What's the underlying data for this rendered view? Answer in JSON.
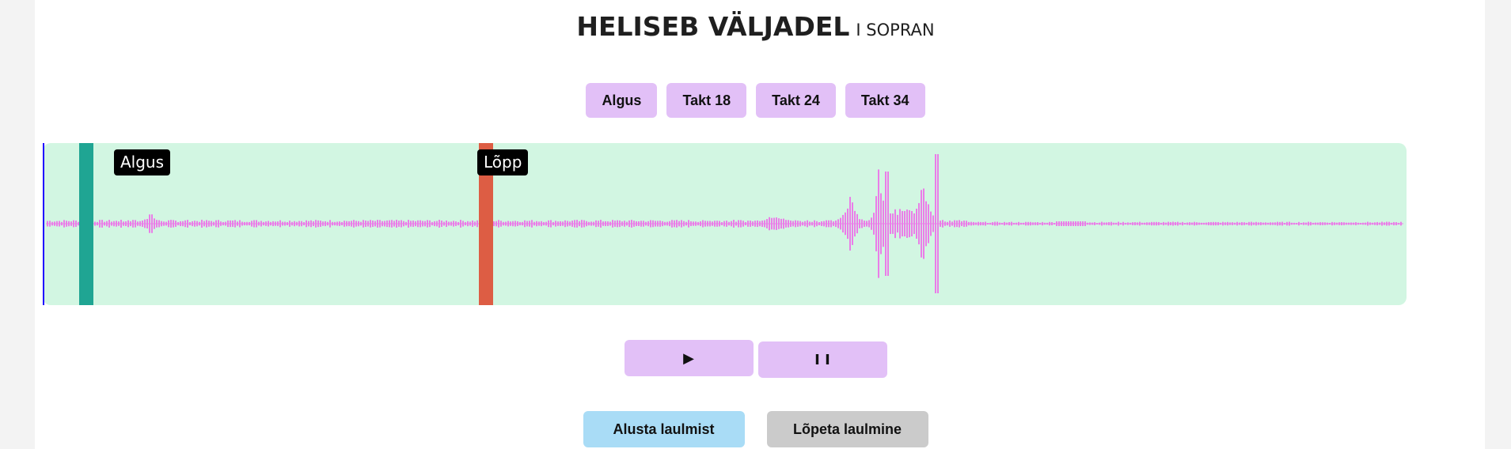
{
  "header": {
    "title": "HELISEB VÄLJADEL",
    "subtitle": "I SOPRAN"
  },
  "markers": [
    "Algus",
    "Takt 18",
    "Takt 24",
    "Takt 34"
  ],
  "waveform": {
    "region_start_label": "Algus",
    "region_end_label": "Lõpp",
    "wave_color": "#ea7de8",
    "background_color": "#d2f6e2",
    "cursor_color": "#1e00ff",
    "start_handle_color": "#1fa593",
    "end_handle_color": "#dd5d44"
  },
  "transport": {
    "play_symbol": "▶",
    "pause_symbol": "I I"
  },
  "singing": {
    "start_label": "Alusta laulmist",
    "stop_label": "Lõpeta laulmine"
  },
  "colors": {
    "button_bg": "#e2c0f7",
    "start_sing_bg": "#a9dcf6",
    "stop_sing_bg": "#cbcbcb"
  }
}
